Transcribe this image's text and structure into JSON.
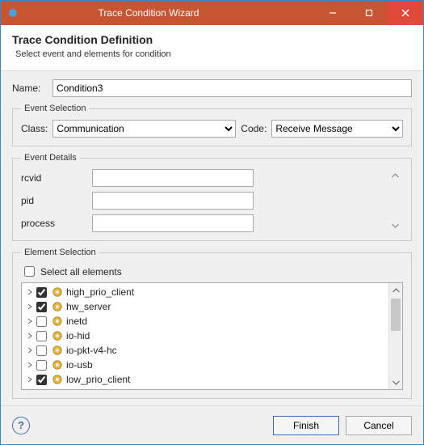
{
  "window": {
    "title": "Trace Condition Wizard"
  },
  "header": {
    "title": "Trace Condition Definition",
    "subtitle": "Select event and elements for condition"
  },
  "name": {
    "label": "Name:",
    "value": "Condition3"
  },
  "eventSelection": {
    "legend": "Event Selection",
    "classLabel": "Class:",
    "classValue": "Communication",
    "codeLabel": "Code:",
    "codeValue": "Receive Message"
  },
  "eventDetails": {
    "legend": "Event Details",
    "fields": [
      {
        "label": "rcvid",
        "value": ""
      },
      {
        "label": "pid",
        "value": ""
      },
      {
        "label": "process",
        "value": ""
      }
    ]
  },
  "elementSelection": {
    "legend": "Element Selection",
    "selectAllLabel": "Select all elements",
    "selectAllChecked": false,
    "items": [
      {
        "label": "high_prio_client",
        "checked": true
      },
      {
        "label": "hw_server",
        "checked": true
      },
      {
        "label": "inetd",
        "checked": false
      },
      {
        "label": "io-hid",
        "checked": false
      },
      {
        "label": "io-pkt-v4-hc",
        "checked": false
      },
      {
        "label": "io-usb",
        "checked": false
      },
      {
        "label": "low_prio_client",
        "checked": true
      }
    ]
  },
  "footer": {
    "finish": "Finish",
    "cancel": "Cancel"
  }
}
